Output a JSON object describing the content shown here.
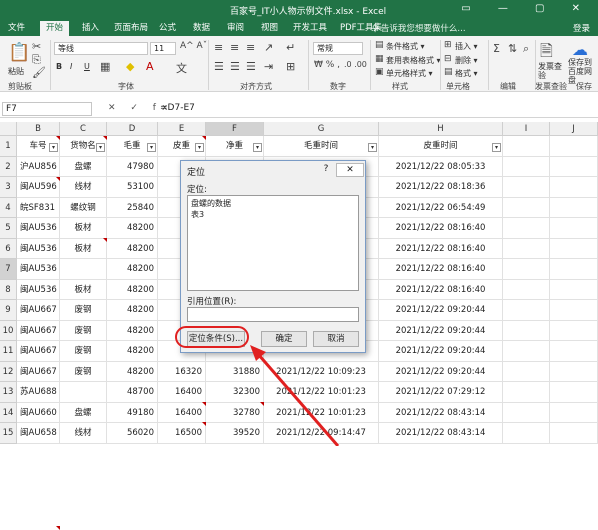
{
  "window": {
    "title": "百家号_IT小人物示例文件.xlsx - Excel",
    "controls": "▭ — ▢ ✕",
    "accent": "#217346"
  },
  "tabs": [
    {
      "label": "文件"
    },
    {
      "label": "开始"
    },
    {
      "label": "插入"
    },
    {
      "label": "页面布局"
    },
    {
      "label": "公式"
    },
    {
      "label": "数据"
    },
    {
      "label": "审阅"
    },
    {
      "label": "视图"
    },
    {
      "label": "开发工具"
    },
    {
      "label": "PDF工具集"
    }
  ],
  "tell_me": "♀ 告诉我您想要做什么...",
  "login": "登录",
  "ribbon": {
    "paste": "粘贴",
    "clipboard": "剪贴板",
    "font_name": "等线",
    "font_size": "11",
    "font_group": "字体",
    "bold": "B",
    "italic": "I",
    "underline": "U",
    "align_group": "对齐方式",
    "number_format": "常规",
    "number_group": "数字",
    "cond_format": "条件格式 ▾",
    "table_format": "套用表格格式 ▾",
    "cell_style": "单元格样式 ▾",
    "styles_group": "样式",
    "insert": "插入 ▾",
    "delete": "删除 ▾",
    "format": "格式 ▾",
    "cells_group": "单元格",
    "editing_group": "编辑",
    "check": "发票查验",
    "invoice_group": "发票查验",
    "save_baidu": "保存到百度网盘",
    "save_group": "保存"
  },
  "formula": {
    "name_box": "F7",
    "fx_icons": "✕ ✓ fx",
    "content": "=D7-E7"
  },
  "columns": [
    "B",
    "C",
    "D",
    "E",
    "F",
    "G",
    "H",
    "I",
    "J"
  ],
  "rows": [
    {
      "n": "1",
      "b": "车号",
      "c": "货物名",
      "d": "毛重",
      "e": "皮重",
      "f": "净重",
      "g": "毛重时间",
      "h": "皮重时间"
    },
    {
      "n": "2",
      "b": "沪AU856",
      "c": "盘螺",
      "d": "47980",
      "e": "1640",
      "f": "",
      "g": "",
      "h": "2021/12/22 08:05:33"
    },
    {
      "n": "3",
      "b": "闽AU596",
      "c": "线材",
      "d": "53100",
      "e": "1610",
      "f": "",
      "g": "",
      "h": "2021/12/22 08:18:36"
    },
    {
      "n": "4",
      "b": "皖SF831",
      "c": "螺纹钢",
      "d": "25840",
      "e": "1620",
      "f": "",
      "g": "",
      "h": "2021/12/22 06:54:49"
    },
    {
      "n": "5",
      "b": "闽AU536",
      "c": "板材",
      "d": "48200",
      "e": "1620",
      "f": "",
      "g": "",
      "h": "2021/12/22 08:16:40"
    },
    {
      "n": "6",
      "b": "闽AU536",
      "c": "板材",
      "d": "48200",
      "e": "1620",
      "f": "",
      "g": "",
      "h": "2021/12/22 08:16:40"
    },
    {
      "n": "7",
      "b": "闽AU536",
      "c": "",
      "d": "48200",
      "e": "1620",
      "f": "",
      "g": "",
      "h": "2021/12/22 08:16:40"
    },
    {
      "n": "8",
      "b": "闽AU536",
      "c": "板材",
      "d": "48200",
      "e": "1620",
      "f": "",
      "g": "",
      "h": "2021/12/22 08:16:40"
    },
    {
      "n": "9",
      "b": "闽AU667",
      "c": "废钢",
      "d": "48200",
      "e": "1620",
      "f": "",
      "g": "",
      "h": "2021/12/22 09:20:44"
    },
    {
      "n": "10",
      "b": "闽AU667",
      "c": "废钢",
      "d": "48200",
      "e": "1620",
      "f": "",
      "g": "",
      "h": "2021/12/22 09:20:44"
    },
    {
      "n": "11",
      "b": "闽AU667",
      "c": "废钢",
      "d": "48200",
      "e": "1632",
      "f": "",
      "g": "",
      "h": "2021/12/22 09:20:44"
    },
    {
      "n": "12",
      "b": "闽AU667",
      "c": "废钢",
      "d": "48200",
      "e": "16320",
      "f": "31880",
      "g": "2021/12/22 10:09:23",
      "h": "2021/12/22 09:20:44"
    },
    {
      "n": "13",
      "b": "苏AU688",
      "c": "",
      "d": "48700",
      "e": "16400",
      "f": "32300",
      "g": "2021/12/22 10:01:23",
      "h": "2021/12/22 07:29:12"
    },
    {
      "n": "14",
      "b": "闽AU660",
      "c": "盘螺",
      "d": "49180",
      "e": "16400",
      "f": "32780",
      "g": "2021/12/22 10:01:23",
      "h": "2021/12/22 08:43:14"
    },
    {
      "n": "15",
      "b": "闽AU658",
      "c": "线材",
      "d": "56020",
      "e": "16500",
      "f": "39520",
      "g": "2021/12/22 09:14:47",
      "h": "2021/12/22 08:43:14"
    }
  ],
  "dialog": {
    "title": "定位",
    "help": "?",
    "close": "✕",
    "goto_label": "定位:",
    "list_items": [
      "盘螺的数据",
      "表3"
    ],
    "ref_label": "引用位置(R):",
    "special_button": "定位条件(S)...",
    "ok_button": "确定",
    "cancel_button": "取消"
  }
}
